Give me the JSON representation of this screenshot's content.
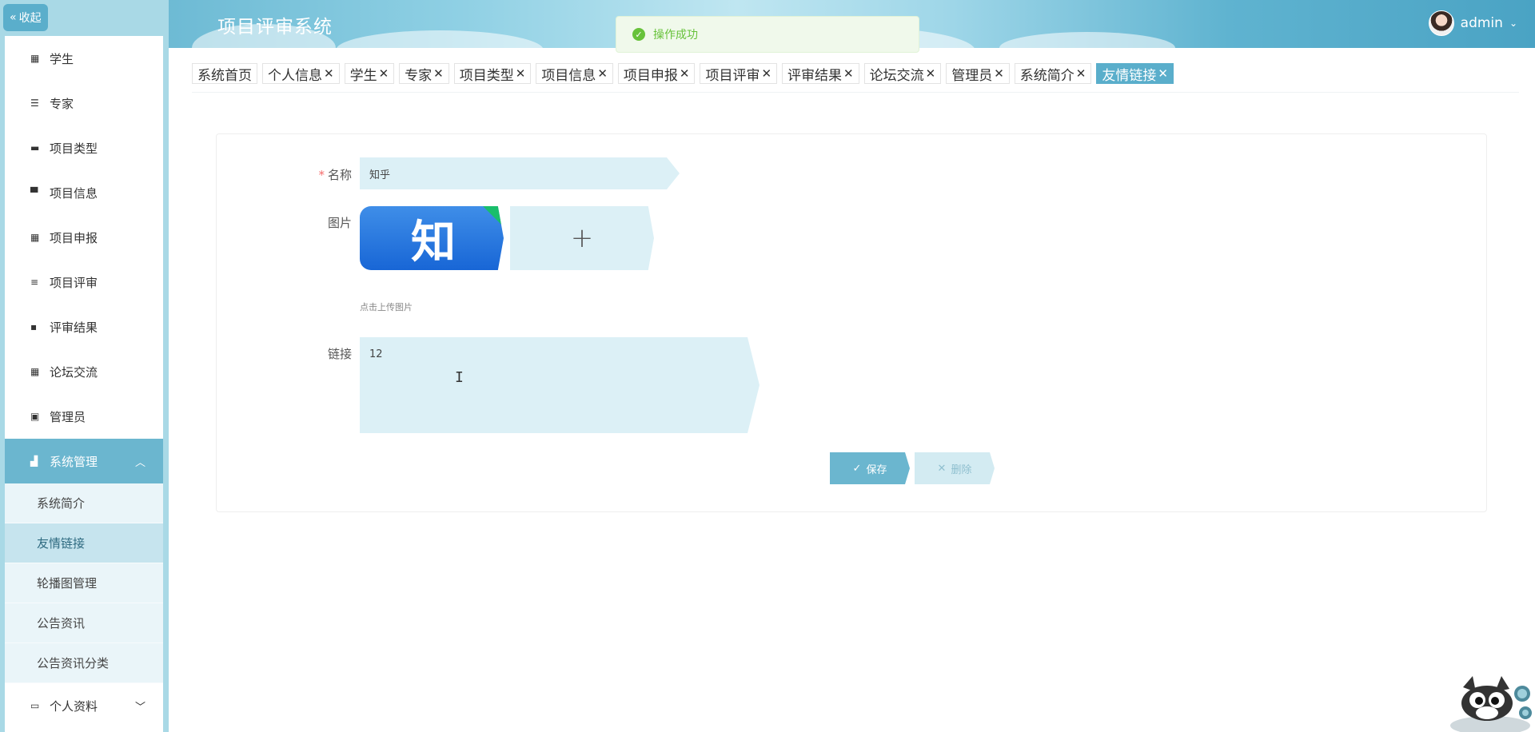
{
  "header": {
    "title": "项目评审系统",
    "username": "admin"
  },
  "toast": {
    "message": "操作成功"
  },
  "sidebar": {
    "collapse_label": "收起",
    "items": [
      {
        "label": "学生",
        "icon": "grid-icon"
      },
      {
        "label": "专家",
        "icon": "list-icon"
      },
      {
        "label": "项目类型",
        "icon": "briefcase-icon"
      },
      {
        "label": "项目信息",
        "icon": "monitor-icon"
      },
      {
        "label": "项目申报",
        "icon": "grid-icon"
      },
      {
        "label": "项目评审",
        "icon": "lines-icon"
      },
      {
        "label": "评审结果",
        "icon": "chat-icon"
      },
      {
        "label": "论坛交流",
        "icon": "grid-icon"
      },
      {
        "label": "管理员",
        "icon": "clipboard-icon"
      }
    ],
    "system_group": {
      "label": "系统管理",
      "children": [
        "系统简介",
        "友情链接",
        "轮播图管理",
        "公告资讯",
        "公告资讯分类"
      ]
    },
    "profile_label": "个人资料"
  },
  "tabs": [
    {
      "label": "系统首页",
      "closable": false,
      "active": false
    },
    {
      "label": "个人信息",
      "closable": true,
      "active": false
    },
    {
      "label": "学生",
      "closable": true,
      "active": false
    },
    {
      "label": "专家",
      "closable": true,
      "active": false
    },
    {
      "label": "项目类型",
      "closable": true,
      "active": false
    },
    {
      "label": "项目信息",
      "closable": true,
      "active": false
    },
    {
      "label": "项目申报",
      "closable": true,
      "active": false
    },
    {
      "label": "项目评审",
      "closable": true,
      "active": false
    },
    {
      "label": "评审结果",
      "closable": true,
      "active": false
    },
    {
      "label": "论坛交流",
      "closable": true,
      "active": false
    },
    {
      "label": "管理员",
      "closable": true,
      "active": false
    },
    {
      "label": "系统简介",
      "closable": true,
      "active": false
    },
    {
      "label": "友情链接",
      "closable": true,
      "active": true
    }
  ],
  "form": {
    "name_label": "名称",
    "name_value": "知乎",
    "image_label": "图片",
    "image_logo_text": "知",
    "upload_tip": "点击上传图片",
    "link_label": "链接",
    "link_value": "12",
    "save_label": "保存",
    "delete_label": "删除"
  },
  "colors": {
    "accent": "#5aaecb",
    "toast_green": "#67c23a",
    "required": "#f56c6c",
    "input_bg": "#dcf0f6"
  }
}
